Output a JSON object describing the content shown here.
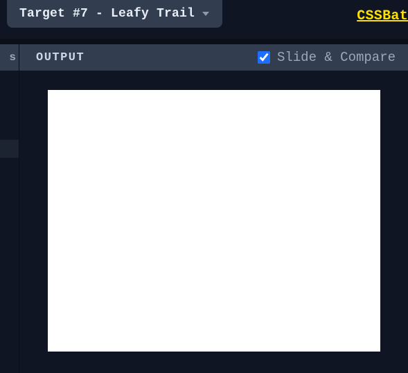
{
  "header": {
    "target_label": "Target #7 - Leafy Trail",
    "brand_link": "CSSBat"
  },
  "sidebar": {
    "tab_suffix": "s"
  },
  "output": {
    "title": "OUTPUT",
    "compare_label": "Slide & Compare",
    "compare_checked": true
  }
}
